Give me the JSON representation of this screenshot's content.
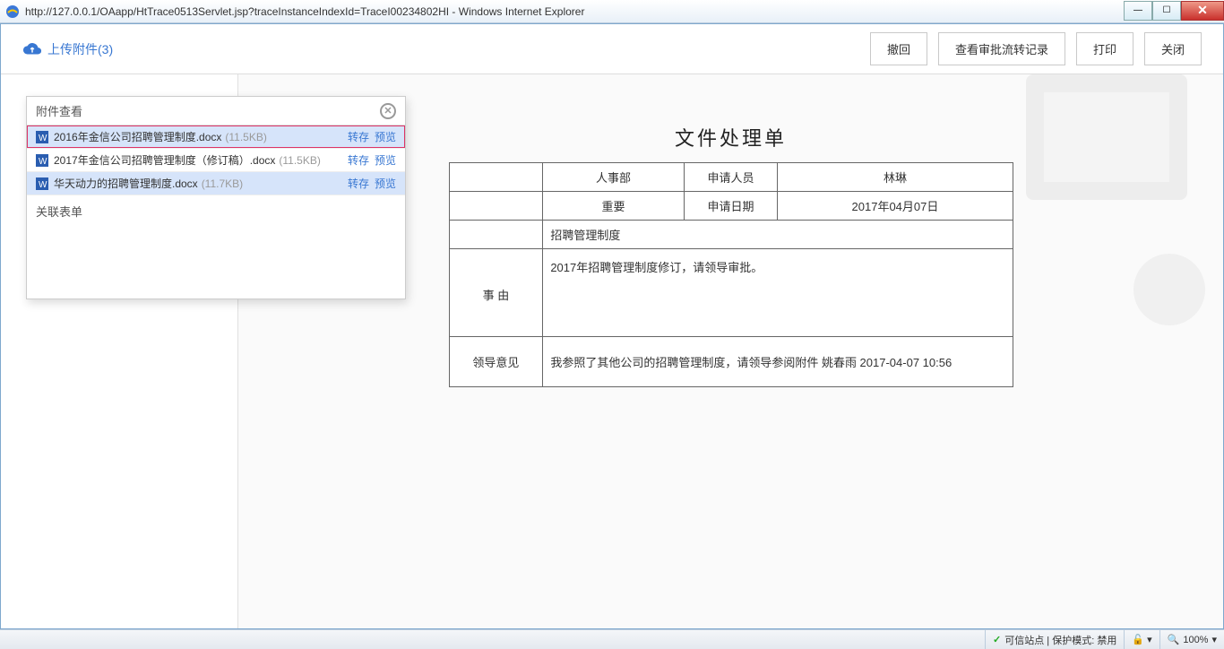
{
  "browser": {
    "title": "http://127.0.0.1/OAapp/HtTrace0513Servlet.jsp?traceInstanceIndexId=TraceI00234802HI - Windows Internet Explorer"
  },
  "header": {
    "upload_label": "上传附件(3)",
    "buttons": {
      "recall": "撤回",
      "history": "查看审批流转记录",
      "print": "打印",
      "close": "关闭"
    }
  },
  "popup": {
    "title": "附件查看",
    "files": [
      {
        "name": "2016年金信公司招聘管理制度.docx",
        "size": "(11.5KB)",
        "a1": "转存",
        "a2": "预览"
      },
      {
        "name": "2017年金信公司招聘管理制度（修订稿）.docx",
        "size": "(11.5KB)",
        "a1": "转存",
        "a2": "预览"
      },
      {
        "name": "华天动力的招聘管理制度.docx",
        "size": "(11.7KB)",
        "a1": "转存",
        "a2": "预览"
      }
    ],
    "related": "关联表单"
  },
  "form": {
    "title": "文件处理单",
    "rows": {
      "dept_label": "",
      "dept": "人事部",
      "applicant_label": "申请人员",
      "applicant": "林琳",
      "importance": "重要",
      "date_label": "申请日期",
      "date": "2017年04月07日",
      "subject": "招聘管理制度",
      "matter_label": "事    由",
      "matter": "2017年招聘管理制度修订，请领导审批。",
      "opinion_label": "领导意见",
      "opinion": "我参照了其他公司的招聘管理制度，请领导参阅附件  姚春雨 2017-04-07 10:56"
    }
  },
  "status": {
    "trusted": "可信站点 | 保护模式: 禁用",
    "zoom": "100%"
  }
}
